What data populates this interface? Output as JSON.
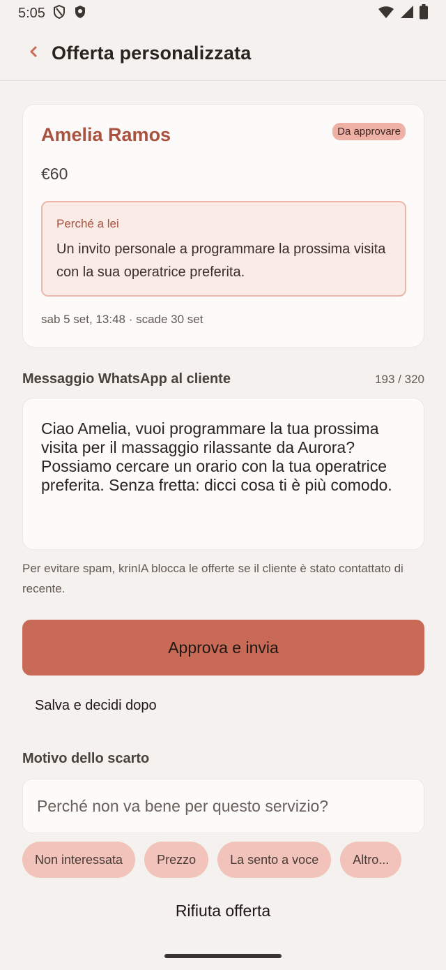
{
  "status_bar": {
    "time": "5:05",
    "icons": [
      "shield-outline-icon",
      "shield-filled-icon",
      "wifi-icon",
      "signal-icon",
      "battery-icon"
    ]
  },
  "header": {
    "title": "Offerta personalizzata",
    "back_icon": "chevron-left-icon"
  },
  "offer": {
    "client_name": "Amelia Ramos",
    "status_badge": "Da approvare",
    "price": "€60",
    "reason_label": "Perché a lei",
    "reason_text": "Un invito personale a programmare la prossima visita con la sua operatrice preferita.",
    "meta": "sab 5 set, 13:48 · scade 30 set"
  },
  "message": {
    "label": "Messaggio WhatsApp al cliente",
    "char_count": "193 / 320",
    "text": "Ciao Amelia, vuoi programmare la tua prossima visita per il massaggio rilassante da Aurora? Possiamo cercare un orario con la tua operatrice preferita. Senza fretta: dicci cosa ti è più comodo."
  },
  "spam_note": "Per evitare spam, krinIA blocca le offerte se il cliente è stato contattato di recente.",
  "actions": {
    "approve_label": "Approva e invia",
    "save_label": "Salva e decidi dopo",
    "reject_label": "Rifiuta offerta"
  },
  "discard": {
    "label": "Motivo dello scarto",
    "placeholder": "Perché non va bene per questo servizio?",
    "chips": [
      "Non interessata",
      "Prezzo",
      "La sento a voce",
      "Altro..."
    ]
  },
  "colors": {
    "accent": "#c86a55",
    "name": "#a9523f",
    "badge": "#efb1a6",
    "chip": "#f1c3ba",
    "background": "#f4f1ee"
  }
}
